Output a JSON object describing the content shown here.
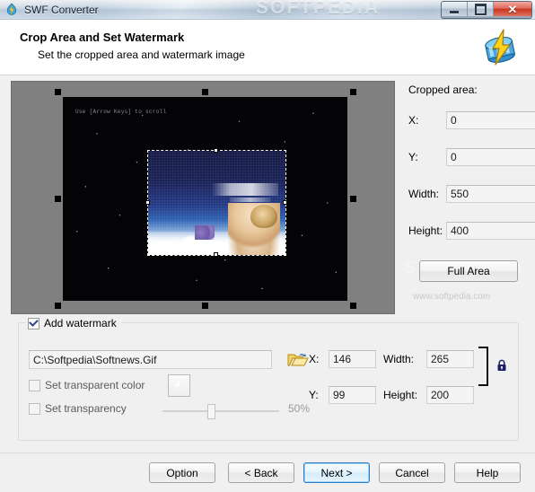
{
  "window": {
    "title": "SWF Converter",
    "app_icon": "swf-app-icon",
    "controls": {
      "minimize": "minimize-button",
      "maximize": "maximize-button",
      "close_glyph": "✕"
    },
    "titlebar_watermark": "SOFTPEDIA"
  },
  "header": {
    "title": "Crop Area and Set Watermark",
    "subtitle": "Set the cropped area and watermark image",
    "logo_icon": "swf-converter-logo-icon"
  },
  "preview": {
    "stage_hint": "Use [Arrow Keys] to scroll",
    "watermark_label": "softpedia",
    "overlay_watermark_text": "SOFTPEDIA",
    "overlay_url_text": "www.softpedia.com"
  },
  "cropped_area": {
    "group_label": "Cropped area:",
    "fields": [
      {
        "label": "X:",
        "value": "0"
      },
      {
        "label": "Y:",
        "value": "0"
      },
      {
        "label": "Width:",
        "value": "550"
      },
      {
        "label": "Height:",
        "value": "400"
      }
    ],
    "full_area_button": "Full Area"
  },
  "watermark": {
    "group_caption": "Add watermark",
    "group_checked": true,
    "path_value": "C:\\Softpedia\\Softnews.Gif",
    "path_placeholder": "",
    "browse_icon": "open-folder-icon",
    "transparent_color_label": "Set transparent color",
    "transparent_color_checked": false,
    "transparent_color_value": "#0b0b0b",
    "transparency_label": "Set transparency",
    "transparency_checked": false,
    "transparency_value": "50%",
    "transparency_percent": 50,
    "position_fields": [
      {
        "label": "X:",
        "value": "146"
      },
      {
        "label": "Width:",
        "value": "265"
      },
      {
        "label": "Y:",
        "value": "99"
      },
      {
        "label": "Height:",
        "value": "200"
      }
    ],
    "lock_icon": "lock-icon"
  },
  "buttons": {
    "option": "Option",
    "back": "< Back",
    "next": "Next >",
    "cancel": "Cancel",
    "help": "Help"
  },
  "colors": {
    "accent": "#2a7fc9",
    "dialog_bg": "#f0f0f0",
    "preview_bg": "#808080",
    "stage_bg": "#040407"
  }
}
